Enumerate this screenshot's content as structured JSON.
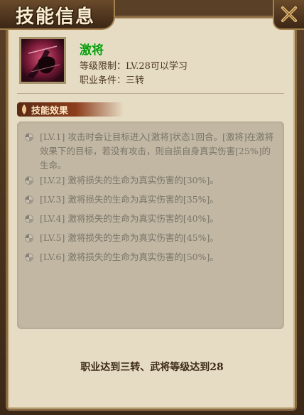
{
  "window": {
    "title": "技能信息"
  },
  "skill": {
    "name": "激将",
    "level_limit": "等级限制：LV.28可以学习",
    "job_condition": "职业条件：三转",
    "icon": "fist-strike-icon"
  },
  "section": {
    "title": "技能效果"
  },
  "effects": [
    {
      "text": "[LV.1] 攻击时会让目标进入[激将]状态1回合。[激将]在激将效果下的目标，若没有攻击，则自损自身真实伤害[25%]的生命。"
    },
    {
      "text": "[LV.2] 激将损失的生命为真实伤害的[30%]。"
    },
    {
      "text": "[LV.3] 激将损失的生命为真实伤害的[35%]。"
    },
    {
      "text": "[LV.4] 激将损失的生命为真实伤害的[40%]。"
    },
    {
      "text": "[LV.5] 激将损失的生命为真实伤害的[45%]。"
    },
    {
      "text": "[LV.6] 激将损失的生命为真实伤害的[50%]。"
    }
  ],
  "requirement": "职业达到三转、武将等级达到28",
  "colors": {
    "panel": "#e6dcc4",
    "skill_name": "#0a9a0a",
    "effect_text_locked": "#7a7568",
    "section_header": "#8c3d1c"
  }
}
